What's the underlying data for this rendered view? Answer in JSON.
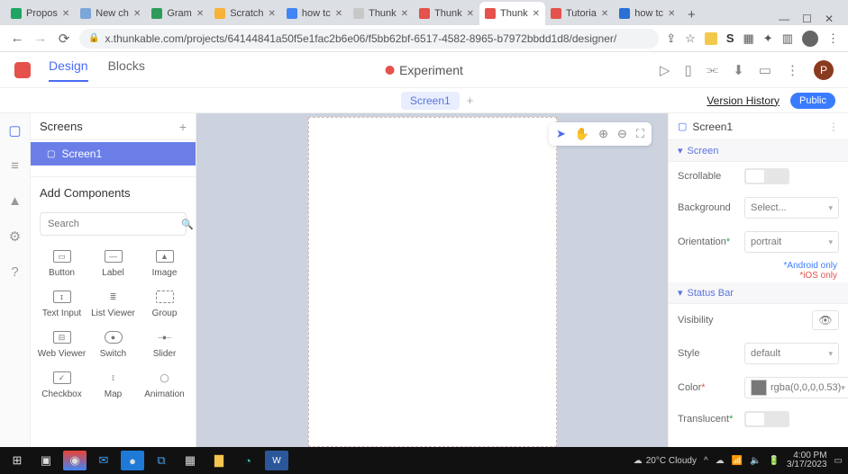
{
  "browser": {
    "tabs": [
      {
        "label": "Propos",
        "color": "#1fa463"
      },
      {
        "label": "New ch",
        "color": "#7aa6d8"
      },
      {
        "label": "Gram",
        "color": "#2d9c5a"
      },
      {
        "label": "Scratch",
        "color": "#f7b239"
      },
      {
        "label": "how tc",
        "color": "#4285f4"
      },
      {
        "label": "Thunk",
        "color": "#c8c8c8"
      },
      {
        "label": "Thunk",
        "color": "#e5514b"
      },
      {
        "label": "Thunk",
        "color": "#e5514b",
        "active": true
      },
      {
        "label": "Tutoria",
        "color": "#e5514b"
      },
      {
        "label": "how tc",
        "color": "#2a6fd6"
      }
    ],
    "url": "x.thunkable.com/projects/64144841a50f5e1fac2b6e06/f5bb62bf-6517-4582-8965-b7972bbdd1d8/designer/"
  },
  "app": {
    "nav": {
      "design": "Design",
      "blocks": "Blocks"
    },
    "title": "Experiment",
    "profile_initial": "P",
    "secondary": {
      "screen_tab": "Screen1",
      "version_history": "Version History",
      "public": "Public"
    }
  },
  "left": {
    "screens_title": "Screens",
    "screen_item": "Screen1",
    "add_components": "Add Components",
    "search_placeholder": "Search",
    "components": [
      {
        "label": "Button"
      },
      {
        "label": "Label"
      },
      {
        "label": "Image"
      },
      {
        "label": "Text Input"
      },
      {
        "label": "List Viewer"
      },
      {
        "label": "Group"
      },
      {
        "label": "Web Viewer"
      },
      {
        "label": "Switch"
      },
      {
        "label": "Slider"
      },
      {
        "label": "Checkbox"
      },
      {
        "label": "Map"
      },
      {
        "label": "Animation"
      }
    ]
  },
  "props": {
    "header": "Screen1",
    "sections": {
      "screen": "Screen",
      "statusbar": "Status Bar"
    },
    "labels": {
      "scrollable": "Scrollable",
      "background": "Background",
      "orientation": "Orientation",
      "visibility": "Visibility",
      "style": "Style",
      "color": "Color",
      "translucent": "Translucent"
    },
    "values": {
      "background": "Select...",
      "orientation": "portrait",
      "android_only": "*Android only",
      "ios_only": "*iOS only",
      "style": "default",
      "color": "rgba(0,0,0,0.53)"
    }
  },
  "taskbar": {
    "weather": "20°C  Cloudy",
    "time": "4:00 PM",
    "date": "3/17/2023"
  }
}
